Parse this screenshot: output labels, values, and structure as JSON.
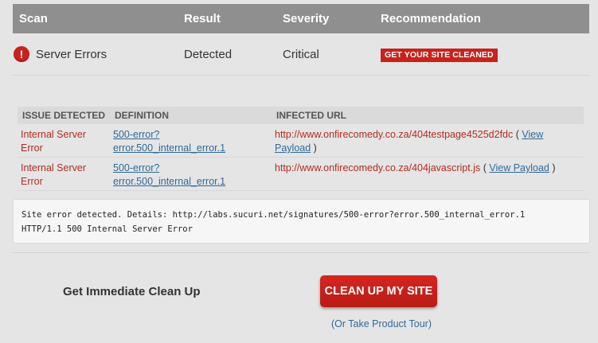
{
  "scan_table": {
    "headers": {
      "scan": "Scan",
      "result": "Result",
      "severity": "Severity",
      "recommendation": "Recommendation"
    },
    "row": {
      "icon": "error-icon",
      "icon_glyph": "!",
      "scan": "Server Errors",
      "result": "Detected",
      "severity": "Critical",
      "recommendation": "GET YOUR SITE CLEANED"
    }
  },
  "issues": {
    "headers": {
      "issue": "ISSUE DETECTED",
      "definition": "DEFINITION",
      "url": "INFECTED URL"
    },
    "rows": [
      {
        "issue": "Internal Server Error",
        "definition": "500-error?error.500_internal_error.1",
        "url": "http://www.onfirecomedy.co.za/404testpage4525d2fdc",
        "open_paren": "(",
        "link": "View Payload",
        "close_paren": ")"
      },
      {
        "issue": "Internal Server Error",
        "definition": "500-error?error.500_internal_error.1",
        "url": "http://www.onfirecomedy.co.za/404javascript.js",
        "open_paren": "(",
        "link": "View Payload",
        "close_paren": ")"
      }
    ]
  },
  "details": {
    "line1": "Site error detected. Details: http://labs.sucuri.net/signatures/500-error?error.500_internal_error.1",
    "line2": "HTTP/1.1 500 Internal Server Error"
  },
  "cta": {
    "label": "Get Immediate Clean Up",
    "button": "CLEAN UP MY SITE",
    "tour_open": "(",
    "tour_link": "Or Take Product Tour",
    "tour_close": ")"
  },
  "colors": {
    "accent_red": "#c9221c",
    "link_blue": "#2f6a9b",
    "header_gray": "#8f8f8f"
  }
}
